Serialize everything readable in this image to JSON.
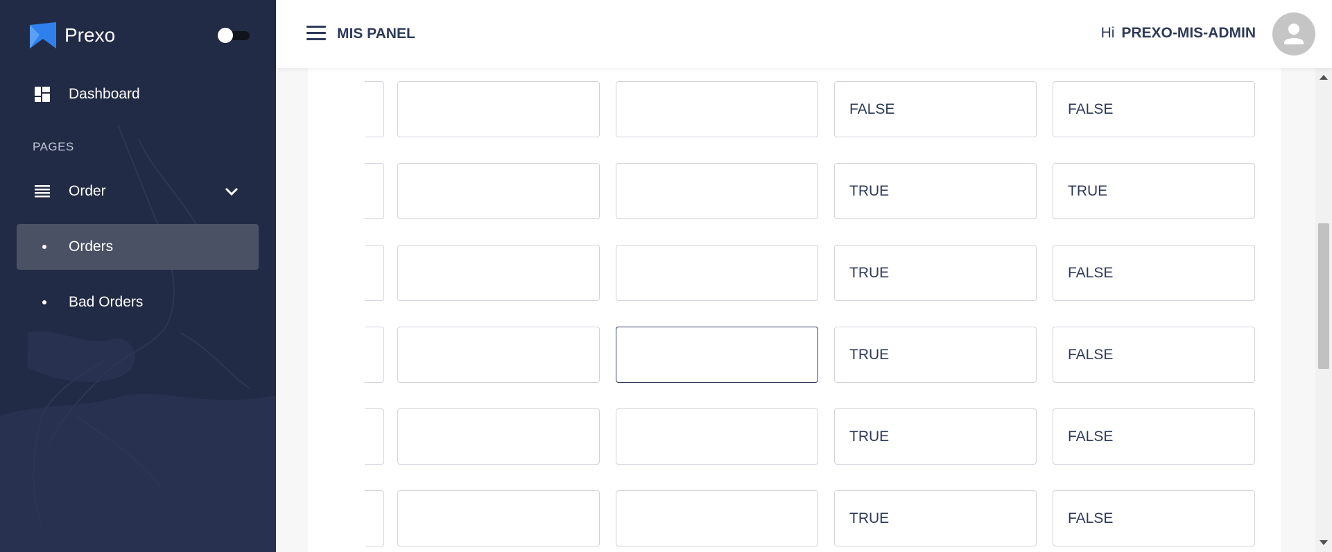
{
  "brand": {
    "name": "Prexo",
    "accent_color": "#2f80ed"
  },
  "sidebar": {
    "background_color": "#222b45",
    "dashboard_label": "Dashboard",
    "section_label": "PAGES",
    "order_label": "Order",
    "sub_items": [
      {
        "label": "Orders",
        "active": true
      },
      {
        "label": "Bad Orders",
        "active": false
      }
    ]
  },
  "header": {
    "title": "MIS PANEL",
    "greeting_prefix": "Hi",
    "username": "PREXO-MIS-ADMIN"
  },
  "grid": {
    "rows": [
      [
        "",
        "",
        "",
        "FALSE",
        "FALSE"
      ],
      [
        "",
        "",
        "",
        "TRUE",
        "TRUE"
      ],
      [
        "",
        "",
        "",
        "TRUE",
        "FALSE"
      ],
      [
        "",
        "",
        "",
        "TRUE",
        "FALSE"
      ],
      [
        "",
        "",
        "",
        "TRUE",
        "FALSE"
      ],
      [
        "",
        "",
        "",
        "TRUE",
        "FALSE"
      ]
    ]
  }
}
